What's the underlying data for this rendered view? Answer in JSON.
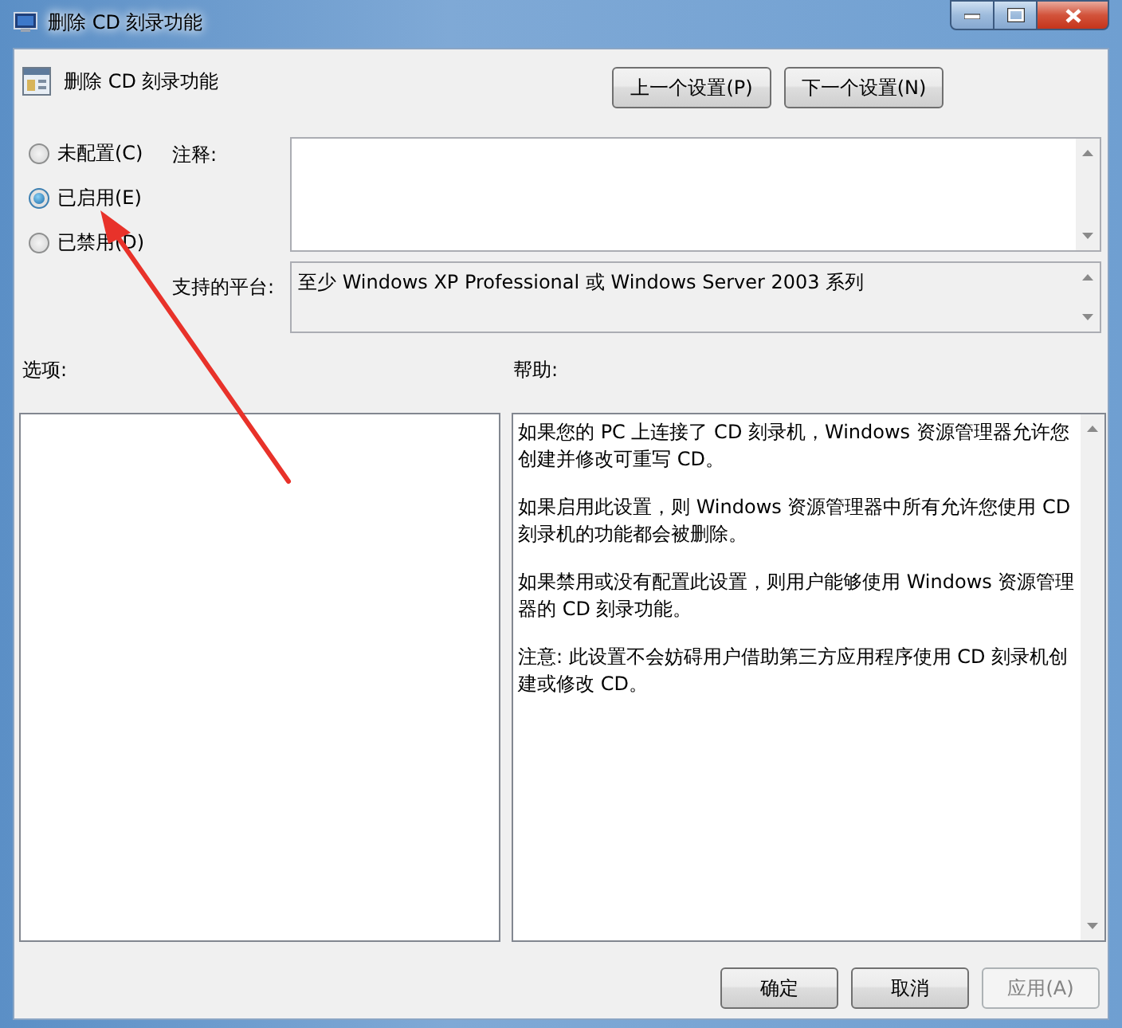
{
  "window": {
    "title": "删除 CD 刻录功能"
  },
  "header": {
    "title": "删除 CD 刻录功能"
  },
  "nav_buttons": [
    {
      "label": "上一个设置(P)"
    },
    {
      "label": "下一个设置(N)"
    }
  ],
  "state_options": [
    {
      "label": "未配置(C)",
      "selected": false
    },
    {
      "label": "已启用(E)",
      "selected": true
    },
    {
      "label": "已禁用(D)",
      "selected": false
    }
  ],
  "comment": {
    "label": "注释:"
  },
  "platform": {
    "label": "支持的平台:",
    "value": "至少 Windows XP Professional 或 Windows Server 2003 系列"
  },
  "options": {
    "label": "选项:"
  },
  "help": {
    "label": "帮助:",
    "paragraphs": [
      "如果您的 PC 上连接了 CD 刻录机，Windows 资源管理器允许您创建并修改可重写 CD。",
      "如果启用此设置，则 Windows 资源管理器中所有允许您使用 CD 刻录机的功能都会被删除。",
      "如果禁用或没有配置此设置，则用户能够使用 Windows 资源管理器的 CD 刻录功能。",
      "注意: 此设置不会妨碍用户借助第三方应用程序使用 CD 刻录机创建或修改 CD。"
    ]
  },
  "buttons": [
    {
      "label": "确定",
      "disabled": false
    },
    {
      "label": "取消",
      "disabled": false
    },
    {
      "label": "应用(A)",
      "disabled": true
    }
  ]
}
